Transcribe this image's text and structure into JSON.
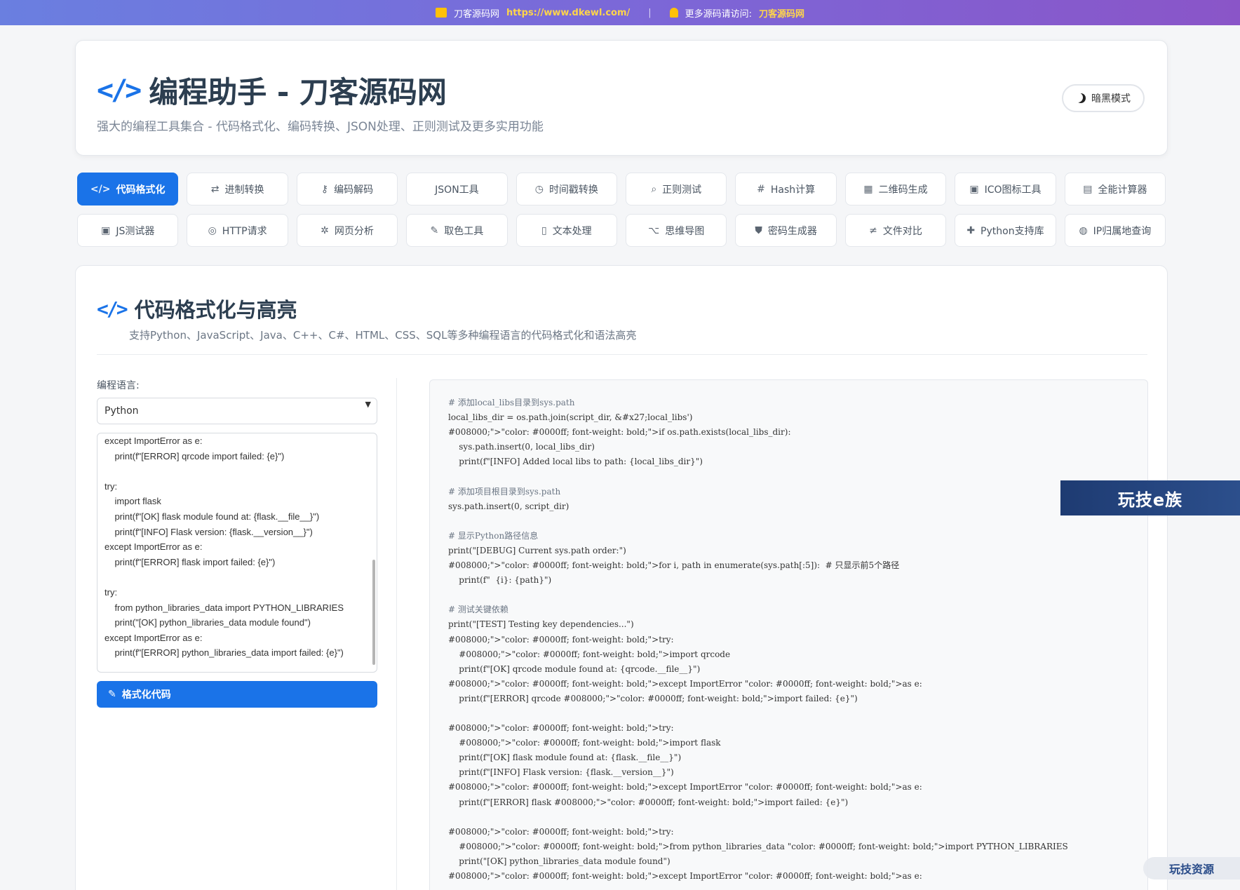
{
  "topbar": {
    "site_name": "刀客源码网",
    "site_url": "https://www.dkewl.com/",
    "separator": "|",
    "more_label": "更多源码请访问:",
    "more_link": "刀客源码网"
  },
  "header": {
    "icon": "code-icon",
    "title": "编程助手 - 刀客源码网",
    "subtitle": "强大的编程工具集合 - 代码格式化、编码转换、JSON处理、正则测试及更多实用功能",
    "dark_mode_label": "暗黑模式"
  },
  "tabs_row1": [
    {
      "icon": "</>",
      "label": "代码格式化"
    },
    {
      "icon": "⇄",
      "label": "进制转换"
    },
    {
      "icon": "⚷",
      "label": "编码解码"
    },
    {
      "icon": "",
      "label": "JSON工具"
    },
    {
      "icon": "◷",
      "label": "时间戳转换"
    },
    {
      "icon": "⌕",
      "label": "正则测试"
    },
    {
      "icon": "#",
      "label": "Hash计算"
    },
    {
      "icon": "▦",
      "label": "二维码生成"
    },
    {
      "icon": "▣",
      "label": "ICO图标工具"
    },
    {
      "icon": "▤",
      "label": "全能计算器"
    }
  ],
  "tabs_row2": [
    {
      "icon": "▣",
      "label": "JS测试器"
    },
    {
      "icon": "◎",
      "label": "HTTP请求"
    },
    {
      "icon": "✲",
      "label": "网页分析"
    },
    {
      "icon": "✎",
      "label": "取色工具"
    },
    {
      "icon": "▯",
      "label": "文本处理"
    },
    {
      "icon": "⌥",
      "label": "思维导图"
    },
    {
      "icon": "⛊",
      "label": "密码生成器"
    },
    {
      "icon": "≠",
      "label": "文件对比"
    },
    {
      "icon": "✚",
      "label": "Python支持库"
    },
    {
      "icon": "◍",
      "label": "IP归属地查询"
    }
  ],
  "section": {
    "title": "代码格式化与高亮",
    "description": "支持Python、JavaScript、Java、C++、C#、HTML、CSS、SQL等多种编程语言的代码格式化和语法高亮",
    "language_label": "编程语言:",
    "language_value": "Python",
    "format_button": "格式化代码"
  },
  "input_lines": [
    "except ImportError as e:",
    "    print(f\"[ERROR] qrcode import failed: {e}\")",
    "",
    "try:",
    "    import flask",
    "    print(f\"[OK] flask module found at: {flask.__file__}\")",
    "    print(f\"[INFO] Flask version: {flask.__version__}\")",
    "except ImportError as e:",
    "    print(f\"[ERROR] flask import failed: {e}\")",
    "",
    "try:",
    "    from python_libraries_data import PYTHON_LIBRARIES",
    "    print(\"[OK] python_libraries_data module found\")",
    "except ImportError as e:",
    "    print(f\"[ERROR] python_libraries_data import failed: {e}\")"
  ],
  "output_lines": [
    "# 添加local_libs目录到sys.path",
    "local_libs_dir = os.path.join(script_dir, &#x27;local_libs')",
    "#008000;\">\"color: #0000ff; font-weight: bold;\">if os.path.exists(local_libs_dir):",
    "    sys.path.insert(0, local_libs_dir)",
    "    print(f\"[INFO] Added local libs to path: {local_libs_dir}\")",
    "",
    "# 添加项目根目录到sys.path",
    "sys.path.insert(0, script_dir)",
    "",
    "# 显示Python路径信息",
    "print(\"[DEBUG] Current sys.path order:\")",
    "#008000;\">\"color: #0000ff; font-weight: bold;\">for i, path in enumerate(sys.path[:5]):  # 只显示前5个路径",
    "    print(f\"  {i}: {path}\")",
    "",
    "# 测试关键依赖",
    "print(\"[TEST] Testing key dependencies...\")",
    "#008000;\">\"color: #0000ff; font-weight: bold;\">try:",
    "    #008000;\">\"color: #0000ff; font-weight: bold;\">import qrcode",
    "    print(f\"[OK] qrcode module found at: {qrcode.__file__}\")",
    "#008000;\">\"color: #0000ff; font-weight: bold;\">except ImportError \"color: #0000ff; font-weight: bold;\">as e:",
    "    print(f\"[ERROR] qrcode #008000;\">\"color: #0000ff; font-weight: bold;\">import failed: {e}\")",
    "",
    "#008000;\">\"color: #0000ff; font-weight: bold;\">try:",
    "    #008000;\">\"color: #0000ff; font-weight: bold;\">import flask",
    "    print(f\"[OK] flask module found at: {flask.__file__}\")",
    "    print(f\"[INFO] Flask version: {flask.__version__}\")",
    "#008000;\">\"color: #0000ff; font-weight: bold;\">except ImportError \"color: #0000ff; font-weight: bold;\">as e:",
    "    print(f\"[ERROR] flask #008000;\">\"color: #0000ff; font-weight: bold;\">import failed: {e}\")",
    "",
    "#008000;\">\"color: #0000ff; font-weight: bold;\">try:",
    "    #008000;\">\"color: #0000ff; font-weight: bold;\">from python_libraries_data \"color: #0000ff; font-weight: bold;\">import PYTHON_LIBRARIES",
    "    print(\"[OK] python_libraries_data module found\")",
    "#008000;\">\"color: #0000ff; font-weight: bold;\">except ImportError \"color: #0000ff; font-weight: bold;\">as e:"
  ],
  "watermarks": {
    "badge": "玩技e族",
    "corner": "玩技资源"
  },
  "colors": {
    "accent": "#1a73e8",
    "link_yellow": "#ffd54a"
  }
}
